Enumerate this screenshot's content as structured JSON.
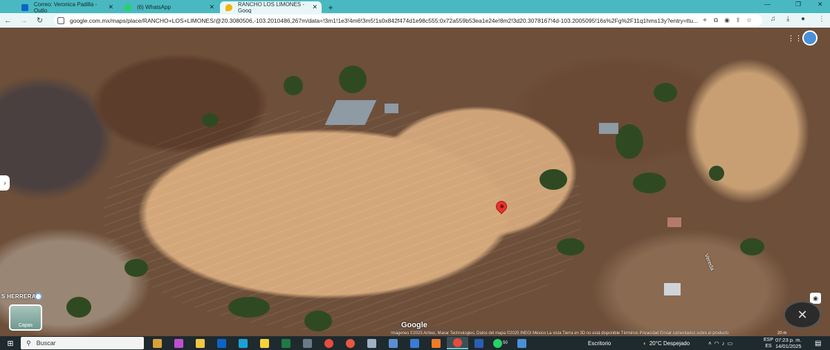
{
  "browser": {
    "tabs": [
      {
        "title": "Correo: Veronica Padilla - Outlo",
        "favicon_color": "#0a64c8",
        "active": false
      },
      {
        "title": "(6) WhatsApp",
        "favicon_color": "#25d366",
        "active": false
      },
      {
        "title": "RANCHO LOS LIMONES - Goog",
        "favicon_color": "#f4b400",
        "active": true
      }
    ],
    "new_tab_label": "+",
    "url": "google.com.mx/maps/place/RANCHO+LOS+LIMONES/@20.3080506,-103.2010486,267m/data=!3m1!1e3!4m6!3m5!1s0x842f474d1e98c555:0x72a559b53ea1e24e!8m2!3d20.3078167!4d-103.2005095!16s%2Fg%2F11q1hms13y?entry=ttu..."
  },
  "map": {
    "place_label": "S HERRERA",
    "layers_label": "Capas",
    "street_label": "Vereda",
    "logo": "Google",
    "attribution": "Imágenes ©2025 Airbus, Maxar Technologies, Datos del mapa ©2025 INEGI     México     La vista Tierra en 3D no está disponible     Términos     Privacidad     Enviar comentarios sobre el producto",
    "scale": "20 m"
  },
  "taskbar": {
    "search_placeholder": "Buscar",
    "apps": [
      {
        "name": "widgets",
        "color": "#d8a23a"
      },
      {
        "name": "copilot",
        "color": "#c04fd0"
      },
      {
        "name": "file-explorer",
        "color": "#f2c744"
      },
      {
        "name": "outlook",
        "color": "#0a64c8"
      },
      {
        "name": "edge",
        "color": "#1aa0d8"
      },
      {
        "name": "sticky-notes",
        "color": "#f7d33a"
      },
      {
        "name": "excel",
        "color": "#1f7a45"
      },
      {
        "name": "calculator",
        "color": "#6b7a84"
      },
      {
        "name": "chrome",
        "color": "#e74c3c"
      },
      {
        "name": "app-red",
        "color": "#e8573f"
      },
      {
        "name": "app-globe",
        "color": "#a0b0c0"
      },
      {
        "name": "app-blue",
        "color": "#5b8fd4"
      },
      {
        "name": "app-people",
        "color": "#3a7bd5"
      },
      {
        "name": "app-orange",
        "color": "#f07a2a"
      },
      {
        "name": "chrome-active",
        "color": "#e74c3c"
      },
      {
        "name": "word",
        "color": "#2b5eb3"
      },
      {
        "name": "whatsapp",
        "color": "#25d366"
      },
      {
        "name": "app-last",
        "color": "#4a90d9"
      }
    ],
    "whatsapp_badge": "50",
    "desktop_label": "Escritorio",
    "weather": "20°C  Despejado",
    "lang_top": "ESP",
    "lang_bottom": "ES",
    "time": "07:23 p. m.",
    "date": "14/01/2025"
  }
}
